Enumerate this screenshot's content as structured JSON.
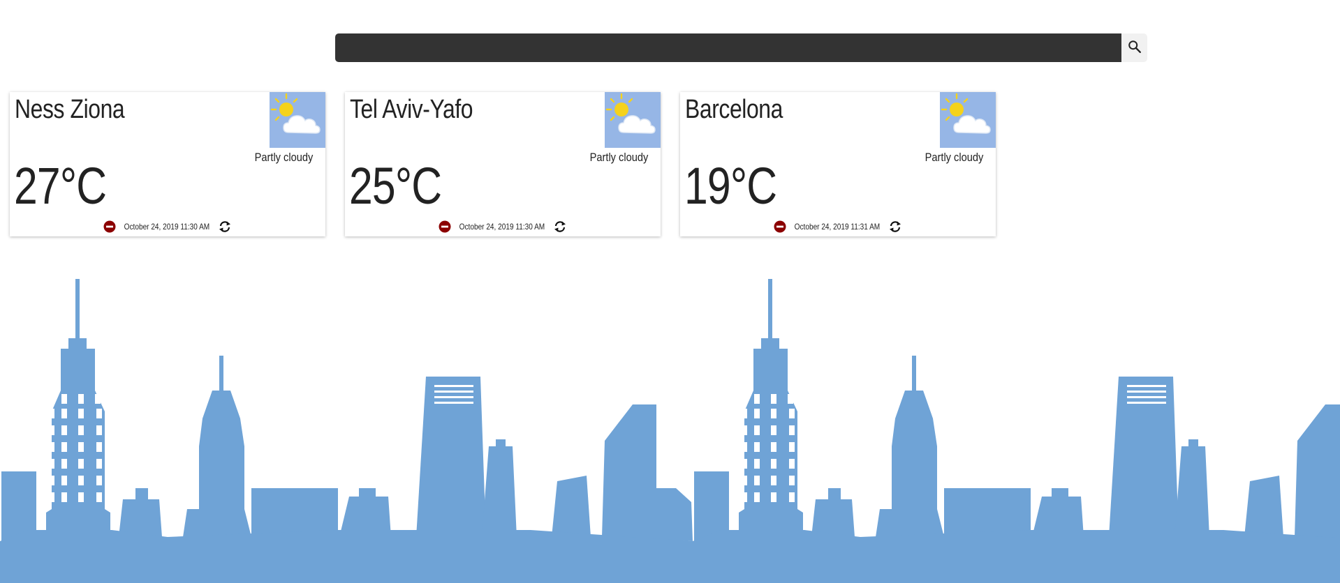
{
  "search": {
    "value": "",
    "placeholder": "",
    "icon": "search-icon"
  },
  "cards": [
    {
      "city": "Ness Ziona",
      "temperature": "27°C",
      "condition": "Partly cloudy",
      "updated": "October 24, 2019 11:30 AM",
      "icon": "partly-cloudy-icon"
    },
    {
      "city": "Tel Aviv-Yafo",
      "temperature": "25°C",
      "condition": "Partly cloudy",
      "updated": "October 24, 2019 11:30 AM",
      "icon": "partly-cloudy-icon"
    },
    {
      "city": "Barcelona",
      "temperature": "19°C",
      "condition": "Partly cloudy",
      "updated": "October 24, 2019 11:31 AM",
      "icon": "partly-cloudy-icon"
    }
  ],
  "colors": {
    "search_bar": "#333333",
    "icon_background": "#96b6e6",
    "remove_icon": "#8b0000",
    "skyline": "#6fa3d6"
  }
}
